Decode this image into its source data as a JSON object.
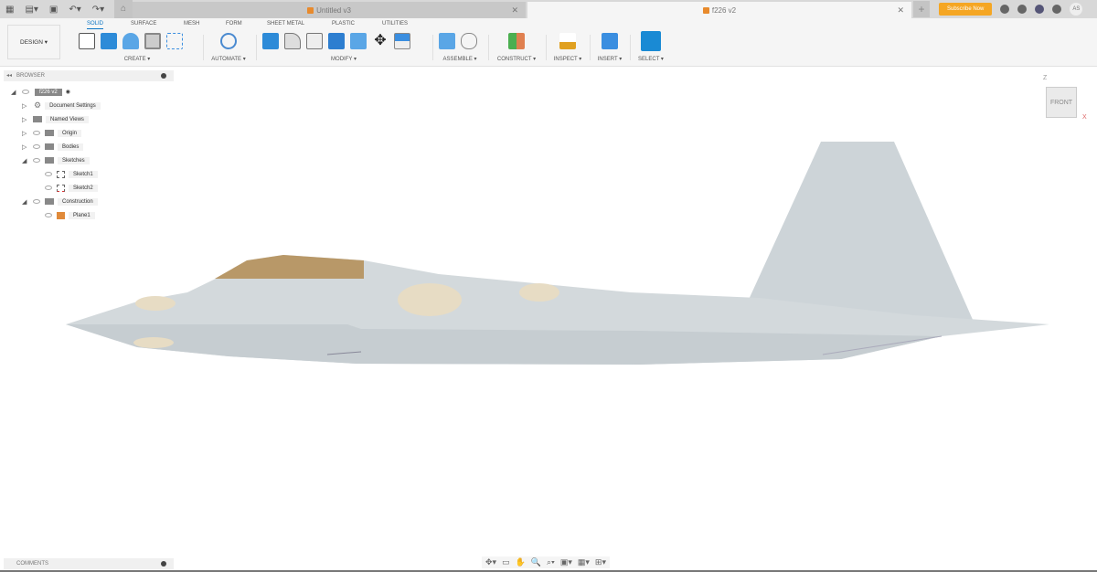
{
  "tabs": [
    {
      "title": "Untitled v3",
      "active": false
    },
    {
      "title": "f226 v2",
      "active": true
    }
  ],
  "header": {
    "subscribe": "Subscribe Now",
    "avatar": "AS"
  },
  "workspace": {
    "label": "DESIGN ▾"
  },
  "ribbon_tabs": [
    "SOLID",
    "SURFACE",
    "MESH",
    "FORM",
    "SHEET METAL",
    "PLASTIC",
    "UTILITIES"
  ],
  "groups": [
    "CREATE ▾",
    "AUTOMATE ▾",
    "MODIFY ▾",
    "ASSEMBLE ▾",
    "CONSTRUCT ▾",
    "INSPECT ▾",
    "INSERT ▾",
    "SELECT ▾"
  ],
  "browser": {
    "title": "BROWSER",
    "items": [
      "f226 v2",
      "Document Settings",
      "Named Views",
      "Origin",
      "Bodies",
      "Sketches",
      "Sketch1",
      "Sketch2",
      "Construction",
      "Plane1"
    ]
  },
  "comments": {
    "title": "COMMENTS"
  },
  "viewcube": {
    "face": "FRONT",
    "z": "Z",
    "x": "X"
  },
  "colors": {
    "accent": "#0a74c4",
    "subscribe": "#f5a623",
    "fuselage": "#d3d9dc",
    "canopy": "#b89868"
  }
}
